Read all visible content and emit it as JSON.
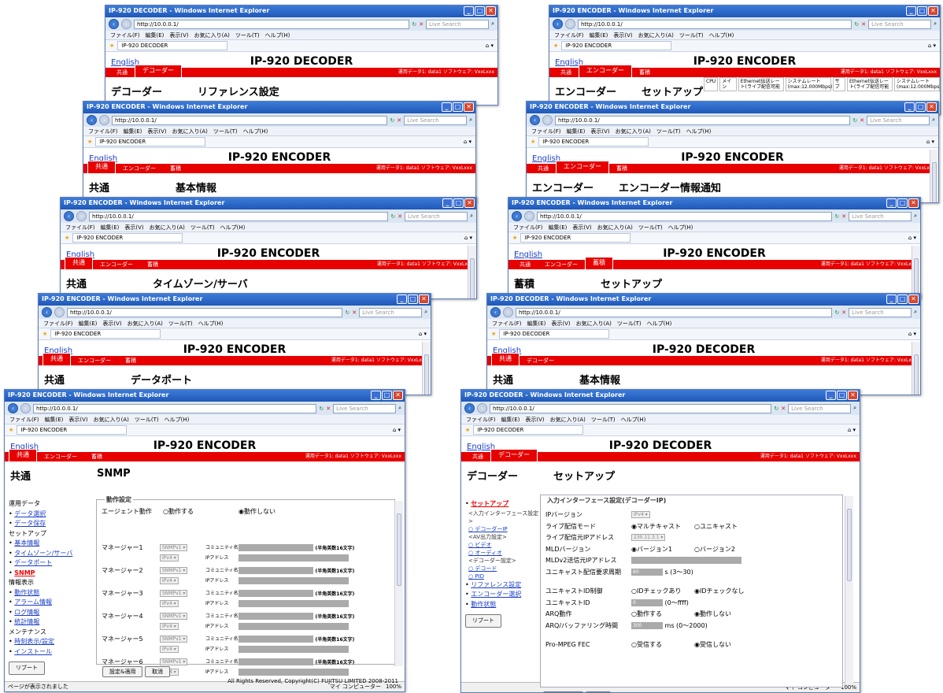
{
  "ie": {
    "url": "http://10.0.0.1/",
    "search_placeholder": "Live Search",
    "menu": "ファイル(F)　編集(E)　表示(V)　お気に入り(A)　ツール(T)　ヘルプ(H)",
    "title_encoder": "IP-920 ENCODER - Windows Internet Explorer",
    "title_decoder": "IP-920 DECODER - Windows Internet Explorer",
    "tab_encoder": "IP-920 ENCODER",
    "tab_decoder": "IP-920 DECODER",
    "status_done": "ページが表示されました",
    "zone": "マイ コンピューター",
    "zoom": "100%"
  },
  "page": {
    "english": "English",
    "encoder_title": "IP-920 ENCODER",
    "decoder_title": "IP-920 DECODER",
    "info": "運用データ1: data1 ソフトウェア: VxxLxxx",
    "tabs": {
      "common": "共通",
      "encoder": "エンコーダー",
      "storage": "蓄積",
      "decoder": "デコーダー"
    },
    "copyright": "All Rights Reserved, Copyright(C) FUJITSU LIMITED 2008-2011",
    "copy_frag": "008-2011",
    "apply": "設定&適用",
    "cancel": "取消",
    "reboot": "リブート"
  },
  "windows": {
    "w1": {
      "head": "デコーダー",
      "sub": "リファレンス設定"
    },
    "w2": {
      "head": "共通",
      "sub": "基本情報"
    },
    "w3": {
      "head": "共通",
      "sub": "タイムゾーン/サーバ"
    },
    "w4": {
      "head": "共通",
      "sub": "データポート"
    },
    "w6": {
      "head": "エンコーダー",
      "sub": "セットアップ",
      "cols": [
        "CPU",
        "メイン",
        "Ethernet伝送レート(ライブ配信可能",
        "システムレート(max:12.000Mbps)",
        "サブ",
        "Ethernet伝送レート(ライブ配信可能",
        "システムレート(max:12.000Mbps)"
      ]
    },
    "w7": {
      "head": "エンコーダー",
      "sub": "エンコーダー情報通知"
    },
    "w8": {
      "head": "蓄積",
      "sub": "セットアップ"
    },
    "w9": {
      "head": "共通",
      "sub": "基本情報"
    }
  },
  "snmp": {
    "head": "共通",
    "sub": "SNMP",
    "section": "動作設定",
    "agent_label": "エージェント動作",
    "agent_on": "動作する",
    "agent_off": "動作しない",
    "managers": [
      "マネージャー1",
      "マネージャー2",
      "マネージャー3",
      "マネージャー4",
      "マネージャー5",
      "マネージャー6"
    ],
    "community": "コミュニティ名",
    "ipaddr": "IPアドレス",
    "hint": "(半角英数16文字)",
    "snmp_sel": "SNMPv1",
    "ip_sel": "IPv4",
    "sidebar": [
      {
        "t": "h",
        "v": "運用データ"
      },
      {
        "t": "a",
        "v": "データ選択"
      },
      {
        "t": "a",
        "v": "データ保存"
      },
      {
        "t": "h",
        "v": "セットアップ"
      },
      {
        "t": "a",
        "v": "基本情報"
      },
      {
        "t": "a",
        "v": "タイムゾーン/サーバ"
      },
      {
        "t": "a",
        "v": "データポート"
      },
      {
        "t": "c",
        "v": "SNMP"
      },
      {
        "t": "h",
        "v": "情報表示"
      },
      {
        "t": "a",
        "v": "動作状態"
      },
      {
        "t": "a",
        "v": "アラーム情報"
      },
      {
        "t": "a",
        "v": "ログ情報"
      },
      {
        "t": "a",
        "v": "統計情報"
      },
      {
        "t": "h",
        "v": "メンテナンス"
      },
      {
        "t": "a",
        "v": "時刻表示/設定"
      },
      {
        "t": "a",
        "v": "インストール"
      }
    ]
  },
  "dec": {
    "head": "デコーダー",
    "sub": "セットアップ",
    "section": "入力インターフェース設定(デコーダーIP)",
    "sidebar": [
      {
        "t": "c",
        "v": "セットアップ"
      },
      {
        "t": "g",
        "v": "<入力インターフェース設定>"
      },
      {
        "t": "s",
        "v": "○ デコーダーIP"
      },
      {
        "t": "g",
        "v": "<AV出力設定>"
      },
      {
        "t": "s",
        "v": "○ ビデオ"
      },
      {
        "t": "s",
        "v": "○ オーディオ"
      },
      {
        "t": "g",
        "v": "<デコーダー設定>"
      },
      {
        "t": "s",
        "v": "○ デコード"
      },
      {
        "t": "s",
        "v": "○ PID"
      },
      {
        "t": "a",
        "v": "リファレンス設定"
      },
      {
        "t": "a",
        "v": "エンコーダー選択"
      },
      {
        "t": "a",
        "v": "動作状態"
      }
    ],
    "rows": [
      {
        "l": "IPバージョン",
        "v": "IPv4"
      },
      {
        "l": "ライブ配信モード",
        "a": "◉マルチキャスト",
        "b": "○ユニキャスト"
      },
      {
        "l": "ライブ配信元IPアドレス",
        "v": "230.11.3.1"
      },
      {
        "l": "MLDバージョン",
        "a": "◉バージョン1",
        "b": "○バージョン2"
      },
      {
        "l": "MLDv2送信元IPアドレス"
      },
      {
        "l": "ユニキャスト配信要求周期",
        "v": "60",
        "u": "s (3〜30)"
      },
      {
        "l": "ユニキャストID制御",
        "a": "○IDチェックあり",
        "b": "◉IDチェックなし"
      },
      {
        "l": "ユニキャストID",
        "v": "0",
        "u": "(0〜ffff)"
      },
      {
        "l": "ARQ動作",
        "a": "○動作する",
        "b": "◉動作しない"
      },
      {
        "l": "ARQ/バッファリング時間",
        "v": "300",
        "u": "ms (0〜2000)"
      },
      {
        "l": "Pro-MPEG FEC",
        "a": "○受信する",
        "b": "◉受信しない"
      }
    ]
  }
}
